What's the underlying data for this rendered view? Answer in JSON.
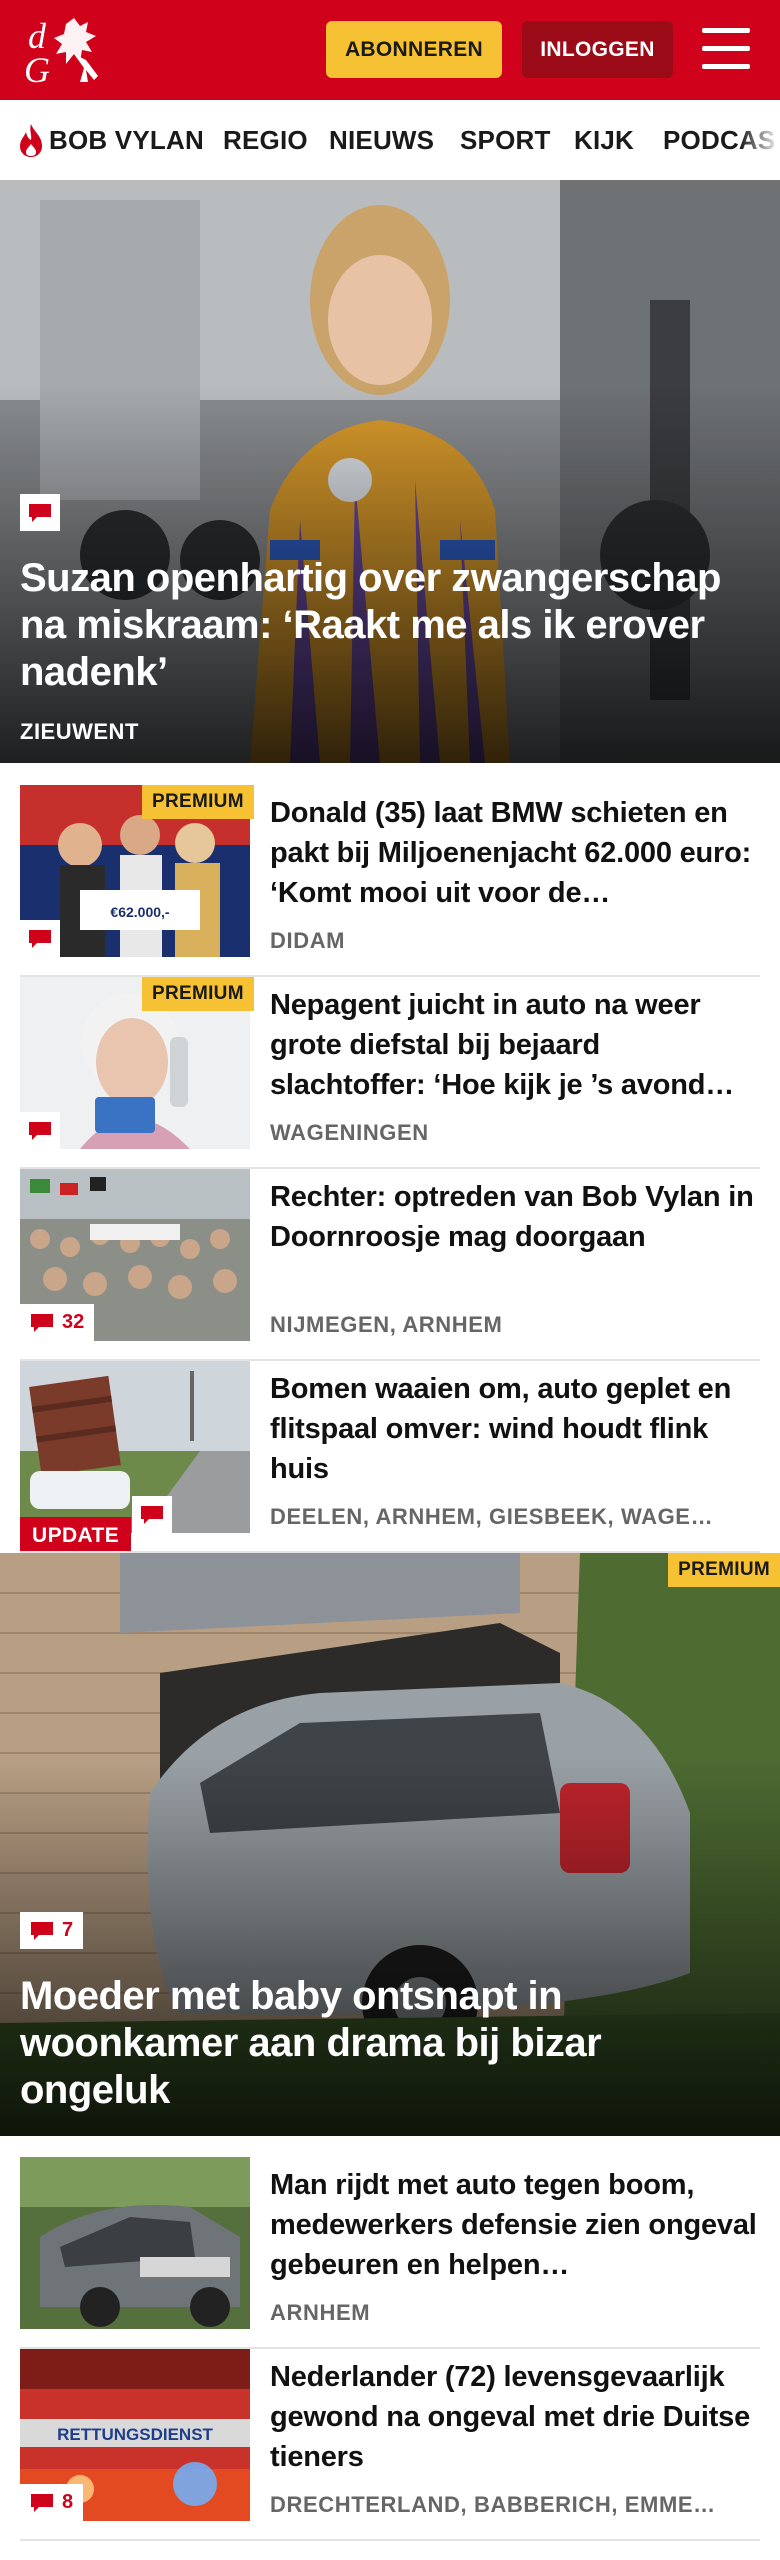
{
  "header": {
    "subscribe_label": "ABONNEREN",
    "login_label": "INLOGGEN",
    "brand_color": "#d0021b",
    "subscribe_color": "#f6c233"
  },
  "nav": {
    "items": [
      {
        "label": "BOB VYLAN",
        "icon": "flame-icon"
      },
      {
        "label": "REGIO"
      },
      {
        "label": "NIEUWS"
      },
      {
        "label": "SPORT"
      },
      {
        "label": "KIJK"
      },
      {
        "label": "PODCAS"
      }
    ]
  },
  "hero1": {
    "title": "Suzan openhartig over zwangerschap na miskraam: ‘Raakt me als ik erover nadenk’",
    "label": "ZIEUWENT"
  },
  "articles_a": [
    {
      "title": "Donald (35) laat BMW schieten en pakt bij Miljoenenjacht 62.000 euro: ‘Komt mooi uit voor de…",
      "location": "DIDAM",
      "premium": "PREMIUM",
      "comments": ""
    },
    {
      "title": "Nepagent juicht in auto na weer grote diefstal bij bejaard slachtoffer: ‘Hoe kijk je ’s avond…",
      "location": "WAGENINGEN",
      "premium": "PREMIUM",
      "comments": ""
    },
    {
      "title": "Rechter: optreden van Bob Vylan in Doornroosje mag doorgaan",
      "location": "NIJMEGEN, ARNHEM",
      "comments": "32"
    },
    {
      "title": "Bomen waaien om, auto geplet en flitspaal omver: wind houdt flink huis",
      "location": "DEELEN, ARNHEM, GIESBEEK, WAGE…",
      "update": "UPDATE",
      "comments": ""
    }
  ],
  "hero2": {
    "title": "Moeder met baby ontsnapt in woonkamer aan drama bij bizar ongeluk",
    "premium": "PREMIUM",
    "comments": "7"
  },
  "articles_b": [
    {
      "title": "Man rijdt met auto tegen boom, medewerkers defensie zien ongeval gebeuren en helpen…",
      "location": "ARNHEM"
    },
    {
      "title": "Nederlander (72) levensgevaar­lijk gewond na ongeval met drie Duitse tieners",
      "location": "DRECHTERLAND, BABBERICH, EMME…",
      "comments": "8",
      "image_text": "RETTUNGSDIENST"
    }
  ]
}
